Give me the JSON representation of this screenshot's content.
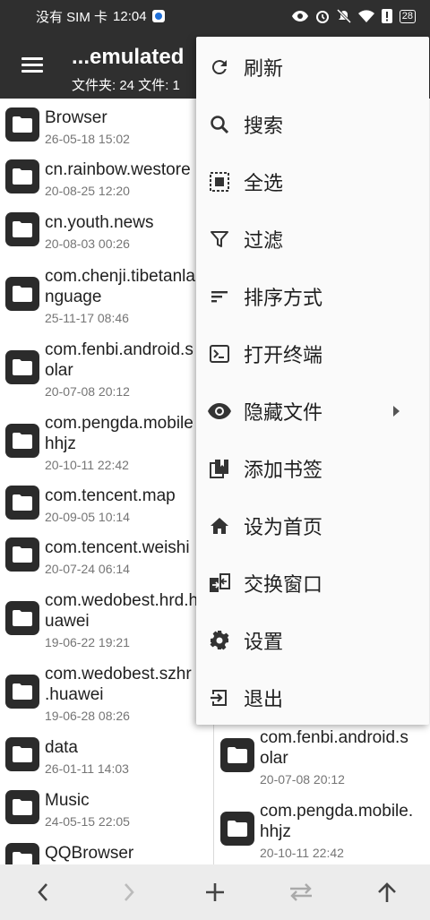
{
  "status_bar": {
    "carrier": "没有 SIM 卡",
    "time": "12:04",
    "battery": "28"
  },
  "app_bar": {
    "title": "...emulated",
    "subtitle": "文件夹: 24  文件: 1"
  },
  "left_pane": {
    "files": [
      {
        "name": "Browser",
        "date": "26-05-18 15:02"
      },
      {
        "name": "cn.rainbow.westore",
        "date": "20-08-25 12:20"
      },
      {
        "name": "cn.youth.news",
        "date": "20-08-03 00:26"
      },
      {
        "name": "com.chenji.tibetanla",
        "name2": "nguage",
        "date": "25-11-17 08:46"
      },
      {
        "name": "com.fenbi.android.s",
        "name2": "olar",
        "date": "20-07-08 20:12"
      },
      {
        "name": "com.pengda.mobile",
        "name2": "hhjz",
        "date": "20-10-11 22:42"
      },
      {
        "name": "com.tencent.map",
        "date": "20-09-05 10:14"
      },
      {
        "name": "com.tencent.weishi",
        "date": "20-07-24 06:14"
      },
      {
        "name": "com.wedobest.hrd.h",
        "name2": "uawei",
        "date": "19-06-22 19:21"
      },
      {
        "name": "com.wedobest.szhr",
        "name2": ".huawei",
        "date": "19-06-28 08:26"
      },
      {
        "name": "data",
        "date": "26-01-11 14:03"
      },
      {
        "name": "Music",
        "date": "24-05-15 22:05"
      },
      {
        "name": "QQBrowser",
        "date": ""
      }
    ]
  },
  "right_pane": {
    "files": [
      {
        "name": "com.fenbi.android.s",
        "name2": "olar",
        "date": "20-07-08 20:12"
      },
      {
        "name": "com.pengda.mobile.",
        "name2": "hhjz",
        "date": "20-10-11 22:42"
      }
    ]
  },
  "menu": {
    "items": [
      {
        "label": "刷新",
        "icon": "refresh-icon"
      },
      {
        "label": "搜索",
        "icon": "search-icon"
      },
      {
        "label": "全选",
        "icon": "select-all-icon"
      },
      {
        "label": "过滤",
        "icon": "filter-icon"
      },
      {
        "label": "排序方式",
        "icon": "sort-icon"
      },
      {
        "label": "打开终端",
        "icon": "terminal-icon"
      },
      {
        "label": "隐藏文件",
        "icon": "eye-icon"
      },
      {
        "label": "添加书签",
        "icon": "bookmark-icon"
      },
      {
        "label": "设为首页",
        "icon": "home-icon"
      },
      {
        "label": "交换窗口",
        "icon": "swap-window-icon"
      },
      {
        "label": "设置",
        "icon": "gear-icon"
      },
      {
        "label": "退出",
        "icon": "exit-icon"
      }
    ]
  },
  "bottom_bar": {
    "buttons": [
      "back-icon",
      "forward-icon",
      "add-icon",
      "swap-icon",
      "up-icon"
    ]
  }
}
